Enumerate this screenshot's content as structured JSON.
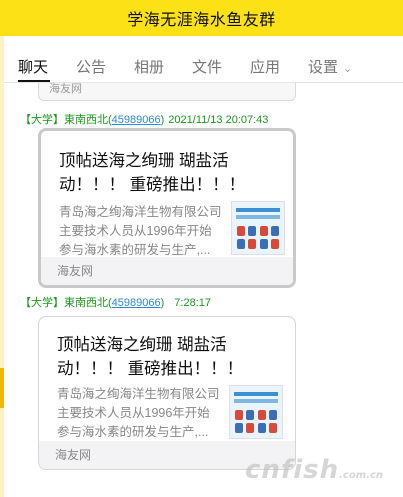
{
  "window": {
    "title": "学海无涯海水鱼友群"
  },
  "tabs": [
    {
      "label": "聊天",
      "active": true
    },
    {
      "label": "公告"
    },
    {
      "label": "相册"
    },
    {
      "label": "文件"
    },
    {
      "label": "应用"
    },
    {
      "label": "设置"
    }
  ],
  "chat": {
    "prev_card_footer": "海友网",
    "messages": [
      {
        "sender_badge": "【大学】",
        "sender_name": "東南西北",
        "sender_qq": "45989066",
        "time": "2021/11/13 20:07:43",
        "card_title": "顶帖送海之绚珊 瑚盐活动！！！ 重磅推出！！！",
        "card_desc_lines": [
          "青岛海之绚海洋生物有限公司",
          "主要技术人员从1996年开始",
          "参与海水素的研发与生产,..."
        ],
        "card_footer": "海友网",
        "thumb_icon": "product-thumbnail-icon"
      },
      {
        "sender_badge": "【大学】",
        "sender_name": "東南西北",
        "sender_qq": "45989066",
        "time": "7:28:17",
        "card_title": "顶帖送海之绚珊 瑚盐活动！！！ 重磅推出！！！",
        "card_desc_lines": [
          "青岛海之绚海洋生物有限公司",
          "主要技术人员从1996年开始",
          "参与海水素的研发与生产,..."
        ],
        "card_footer": "海友网",
        "thumb_icon": "product-thumbnail-icon"
      }
    ]
  },
  "watermark": {
    "main": "cnfish",
    "suffix": ".com.cn"
  },
  "colors": {
    "accent": "#fbe116",
    "sender": "#1a9a1a",
    "link": "#2a8ad8"
  }
}
